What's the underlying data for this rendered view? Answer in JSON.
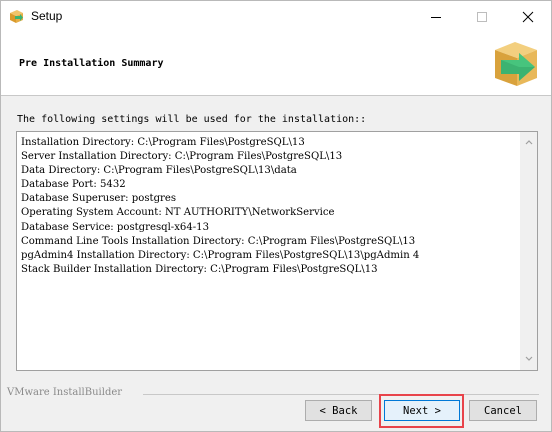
{
  "window": {
    "title": "Setup",
    "icon": "setup-package-icon"
  },
  "titlebar_buttons": {
    "minimize": "minimize-icon",
    "maximize": "maximize-icon",
    "close": "close-icon"
  },
  "header": {
    "title": "Pre Installation Summary",
    "logo": "installer-box-arrow-icon"
  },
  "content": {
    "intro": "The following settings will be used for the installation::",
    "summary_lines": [
      "Installation Directory: C:\\Program Files\\PostgreSQL\\13",
      "Server Installation Directory: C:\\Program Files\\PostgreSQL\\13",
      "Data Directory: C:\\Program Files\\PostgreSQL\\13\\data",
      "Database Port: 5432",
      "Database Superuser: postgres",
      "Operating System Account: NT AUTHORITY\\NetworkService",
      "Database Service: postgresql-x64-13",
      "Command Line Tools Installation Directory: C:\\Program Files\\PostgreSQL\\13",
      "pgAdmin4 Installation Directory: C:\\Program Files\\PostgreSQL\\13\\pgAdmin 4",
      "Stack Builder Installation Directory: C:\\Program Files\\PostgreSQL\\13"
    ]
  },
  "footer": {
    "brand": "VMware InstallBuilder",
    "back_label": "< Back",
    "next_label": "Next >",
    "cancel_label": "Cancel"
  },
  "colors": {
    "highlight": "#e8434a",
    "focus_border": "#0078d7",
    "logo_box": "#e8b85a",
    "logo_arrow": "#3cb371"
  }
}
